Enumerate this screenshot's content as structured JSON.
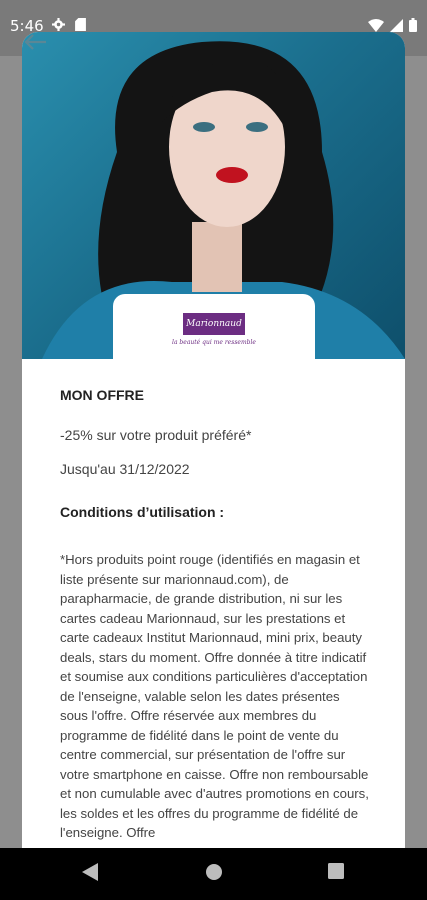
{
  "status_bar": {
    "time": "5:46",
    "icons_left": [
      "gear-icon",
      "sd-card-icon"
    ],
    "icons_right": [
      "wifi-icon",
      "signal-icon",
      "battery-icon"
    ]
  },
  "brand": {
    "name": "Marionnaud",
    "tagline": "la beauté qui me ressemble",
    "color": "#6c2d82"
  },
  "offer": {
    "heading": "MON OFFRE",
    "description": "-25% sur votre produit préféré*",
    "validity": "Jusqu'au 31/12/2022",
    "conditions_heading": "Conditions d’utilisation :",
    "conditions_text": "*Hors produits point rouge (identifiés en magasin et liste présente sur marionnaud.com), de parapharmacie, de grande distribution, ni sur les cartes cadeau Marionnaud, sur les prestations et carte cadeaux Institut Marionnaud, mini prix, beauty deals, stars du moment. Offre donnée à titre indicatif et soumise aux conditions particulières d'acceptation de l'enseigne, valable selon les dates présentes sous l'offre. Offre réservée aux membres du programme de fidélité dans le point de vente du centre commercial, sur présentation de l'offre sur votre smartphone en caisse. Offre non remboursable et non cumulable avec d'autres promotions en cours, les soldes et les offres du programme de fidélité de l'enseigne. Offre"
  },
  "nav": {
    "buttons": [
      "back-triangle-icon",
      "home-circle-icon",
      "recents-square-icon"
    ]
  }
}
